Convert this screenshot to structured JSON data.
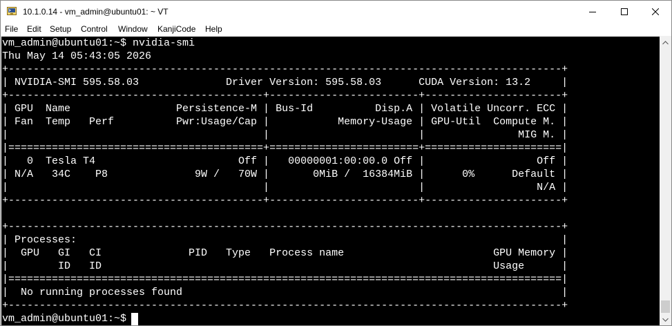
{
  "window": {
    "title": "10.1.0.14 - vm_admin@ubuntu01: ~ VT",
    "app_icon": "teraterm-icon",
    "controls": {
      "minimize_icon": "minimize-icon",
      "maximize_icon": "maximize-icon",
      "close_icon": "close-icon"
    }
  },
  "menu": [
    "File",
    "Edit",
    "Setup",
    "Control",
    "Window",
    "KanjiCode",
    "Help"
  ],
  "terminal": {
    "lines": [
      "vm_admin@ubuntu01:~$ nvidia-smi",
      "Thu May 14 05:43:05 2026",
      "+-----------------------------------------------------------------------------------------+",
      "| NVIDIA-SMI 595.58.03              Driver Version: 595.58.03      CUDA Version: 13.2     |",
      "+-----------------------------------------+------------------------+----------------------+",
      "| GPU  Name                 Persistence-M | Bus-Id          Disp.A | Volatile Uncorr. ECC |",
      "| Fan  Temp   Perf          Pwr:Usage/Cap |           Memory-Usage | GPU-Util  Compute M. |",
      "|                                         |                        |               MIG M. |",
      "|=========================================+========================+======================|",
      "|   0  Tesla T4                       Off |   00000001:00:00.0 Off |                  Off |",
      "| N/A   34C    P8              9W /   70W |       0MiB /  16384MiB |      0%      Default |",
      "|                                         |                        |                  N/A |",
      "+-----------------------------------------+------------------------+----------------------+",
      "",
      "+-----------------------------------------------------------------------------------------+",
      "| Processes:                                                                              |",
      "|  GPU   GI   CI              PID   Type   Process name                        GPU Memory |",
      "|        ID   ID                                                               Usage      |",
      "|=========================================================================================|",
      "|  No running processes found                                                             |",
      "+-----------------------------------------------------------------------------------------+",
      "vm_admin@ubuntu01:~$ "
    ]
  },
  "colors": {
    "terminal_bg": "#000000",
    "terminal_fg": "#ffffff",
    "chrome_bg": "#ffffff",
    "scrollbar_bg": "#f0f0f0"
  }
}
